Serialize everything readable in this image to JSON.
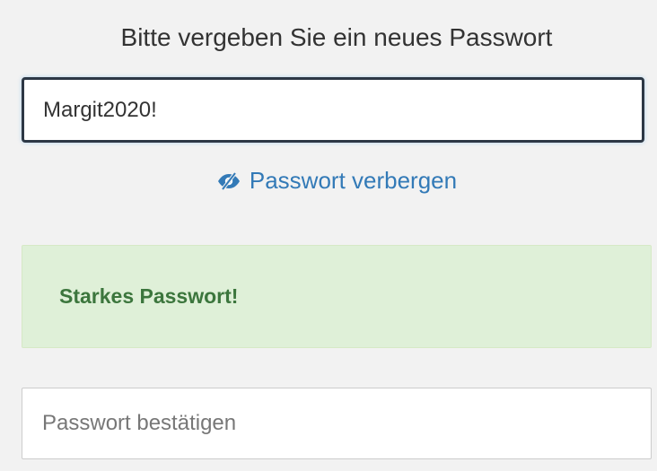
{
  "form": {
    "title": "Bitte vergeben Sie ein neues Passwort",
    "password": {
      "value": "Margit2020!"
    },
    "toggle": {
      "icon": "eye-slash-icon",
      "label": "Passwort verbergen"
    },
    "strength": {
      "message": "Starkes Passwort!"
    },
    "confirm": {
      "value": "",
      "placeholder": "Passwort bestätigen"
    }
  },
  "colors": {
    "link": "#337ab7",
    "success_text": "#3c763d",
    "success_bg": "#dff0d8",
    "focus_border": "#2d3845",
    "page_bg": "#f2f2f2"
  }
}
